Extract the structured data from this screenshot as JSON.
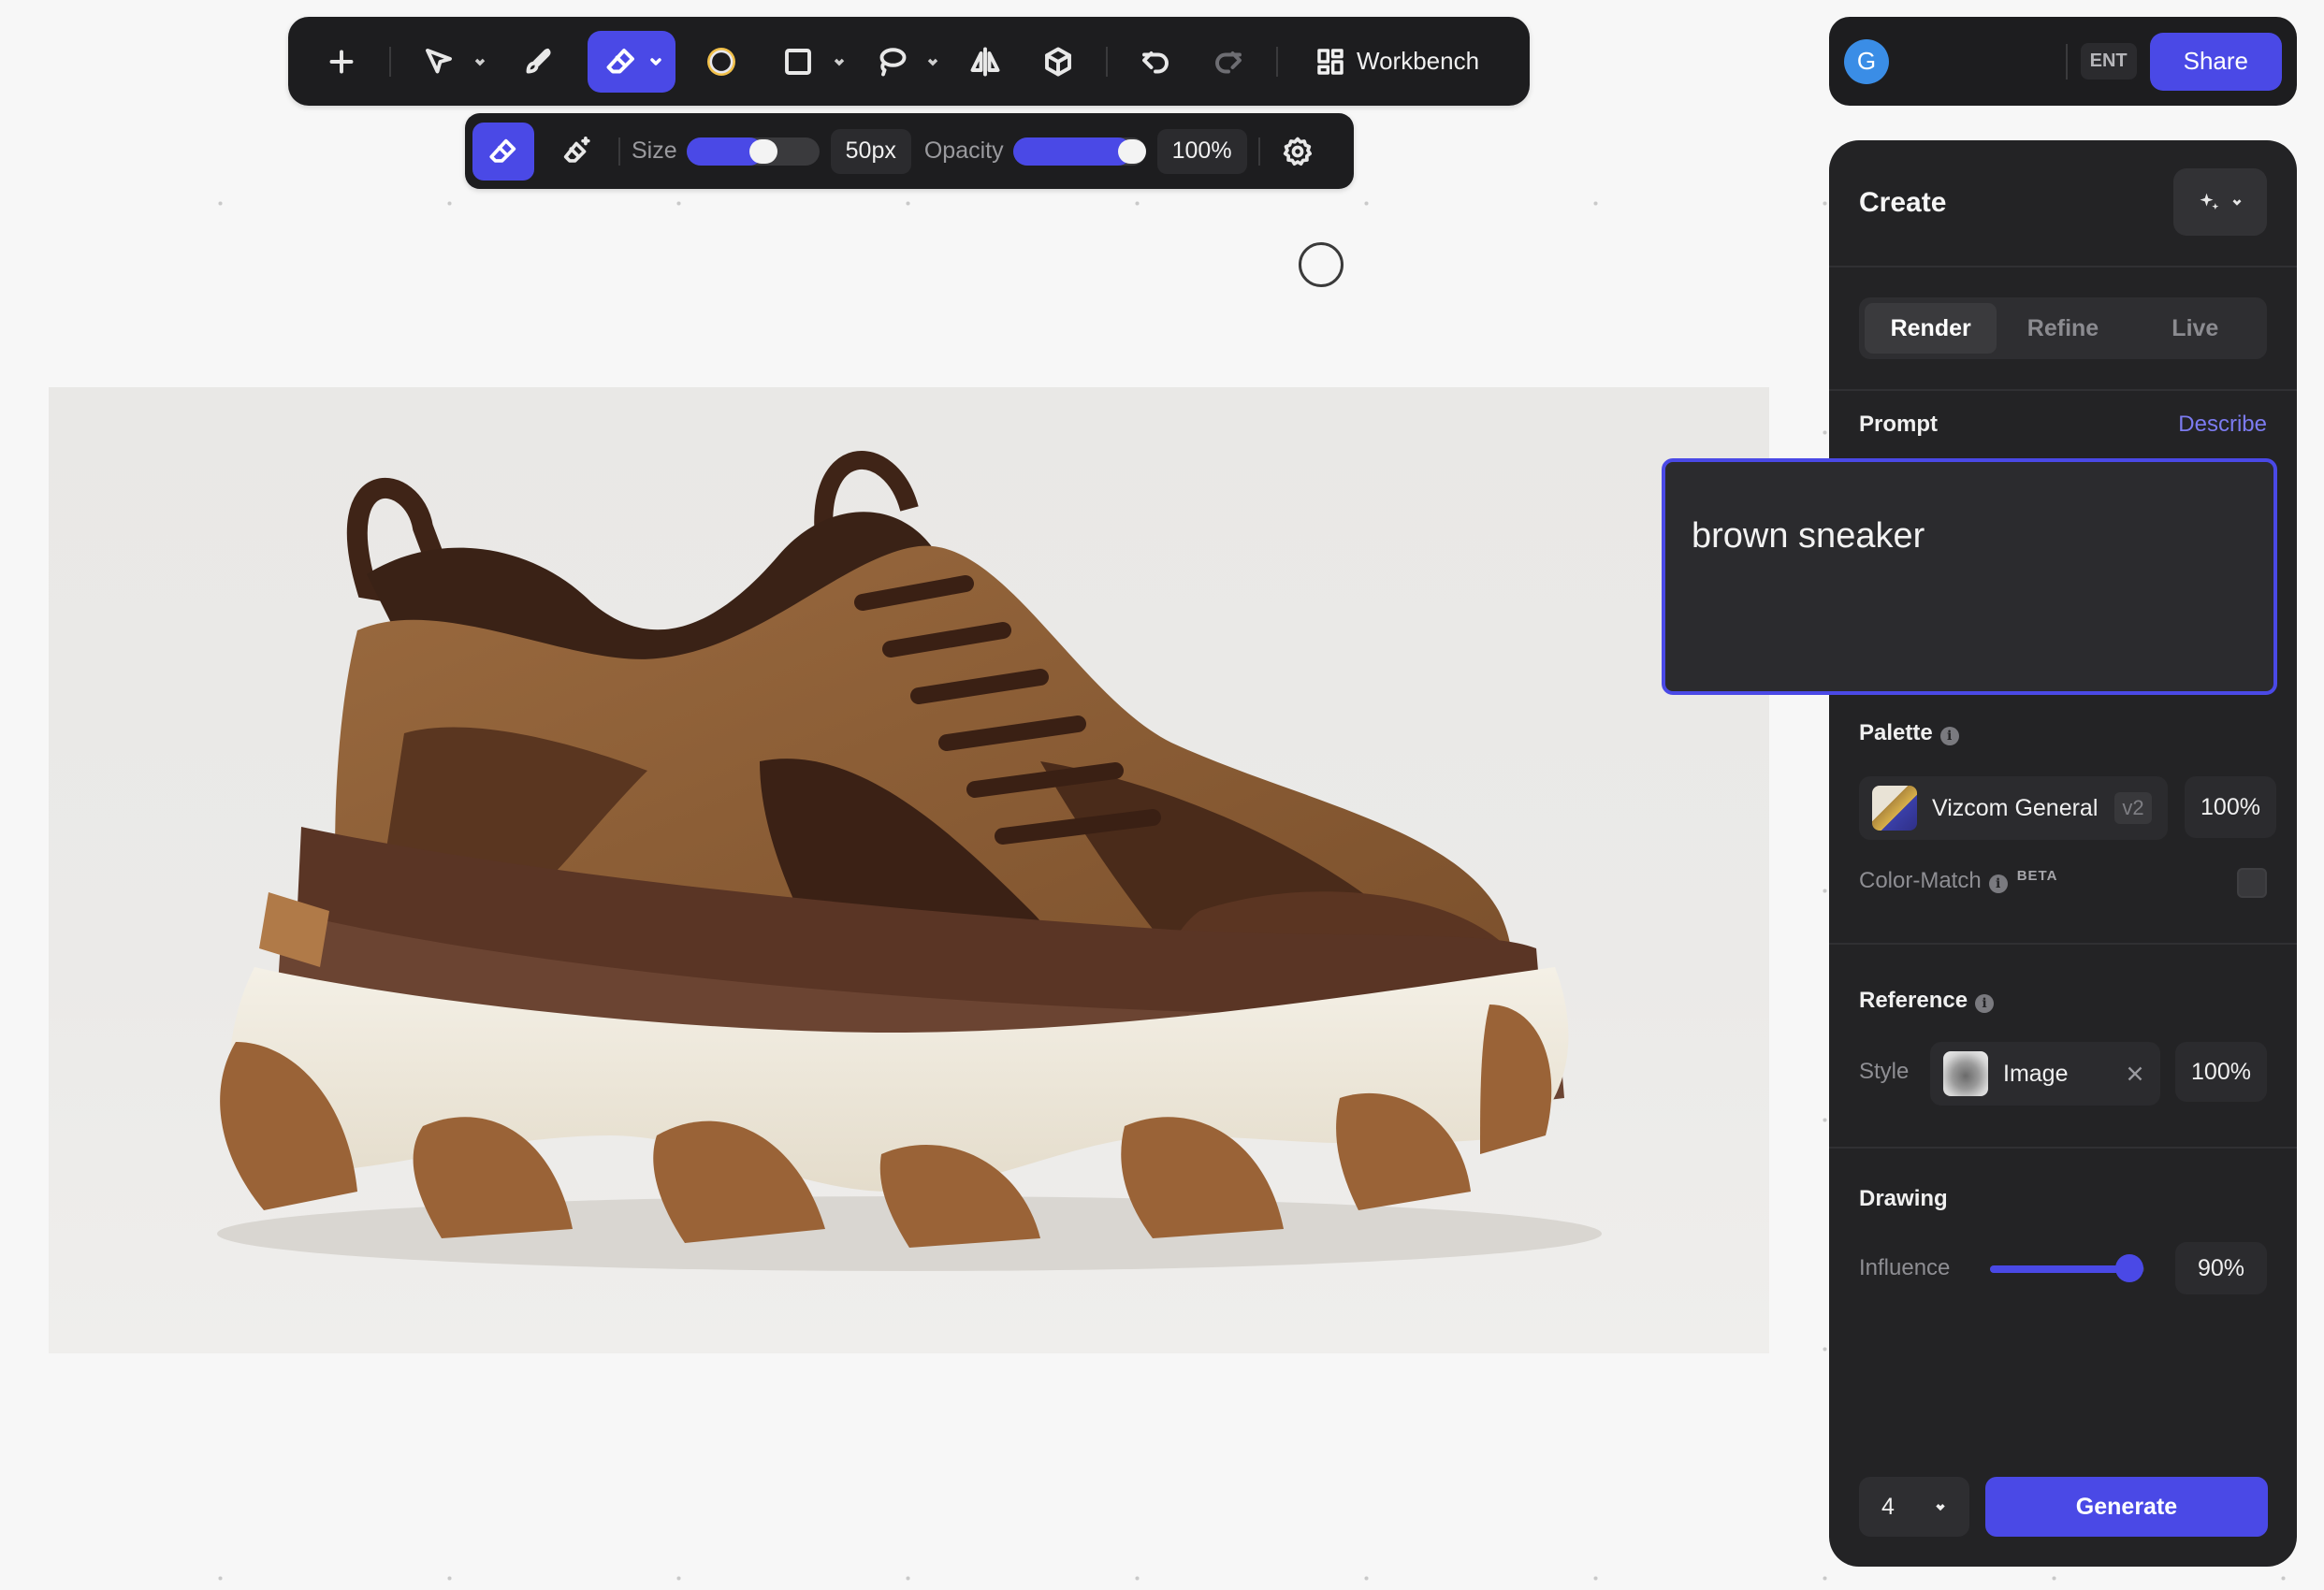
{
  "toolbar": {
    "tools": [
      "add-icon",
      "select-icon",
      "brush-icon",
      "eraser-icon",
      "color-ring-icon",
      "rectangle-icon",
      "lasso-icon",
      "mirror-icon",
      "3d-box-icon",
      "undo-icon",
      "redo-icon"
    ],
    "active_tool": "eraser",
    "workbench_label": "Workbench"
  },
  "subbar": {
    "size_label": "Size",
    "size_value": "50px",
    "size_level": 0.58,
    "opacity_label": "Opacity",
    "opacity_value": "100%",
    "opacity_level": 1.0
  },
  "account": {
    "avatar_initial": "G",
    "plan_badge": "ENT",
    "share_label": "Share"
  },
  "panel": {
    "title": "Create",
    "tabs": [
      {
        "label": "Render",
        "selected": true
      },
      {
        "label": "Refine",
        "selected": false
      },
      {
        "label": "Live",
        "selected": false
      }
    ],
    "prompt": {
      "label": "Prompt",
      "describe_label": "Describe",
      "text": "brown sneaker"
    },
    "palette": {
      "label": "Palette",
      "name": "Vizcom General",
      "version": "v2",
      "strength": "100%",
      "color_match_label": "Color-Match",
      "beta_label": "BETA"
    },
    "reference": {
      "label": "Reference",
      "style_label": "Style",
      "image_label": "Image",
      "strength": "100%"
    },
    "drawing": {
      "label": "Drawing",
      "influence_label": "Influence",
      "influence_value": "90%",
      "influence_level": 0.9
    },
    "count": "4",
    "generate_label": "Generate"
  },
  "colors": {
    "accent": "#4a49e6",
    "panel_bg": "#232325",
    "toolbar_bg": "#1d1d1f"
  }
}
